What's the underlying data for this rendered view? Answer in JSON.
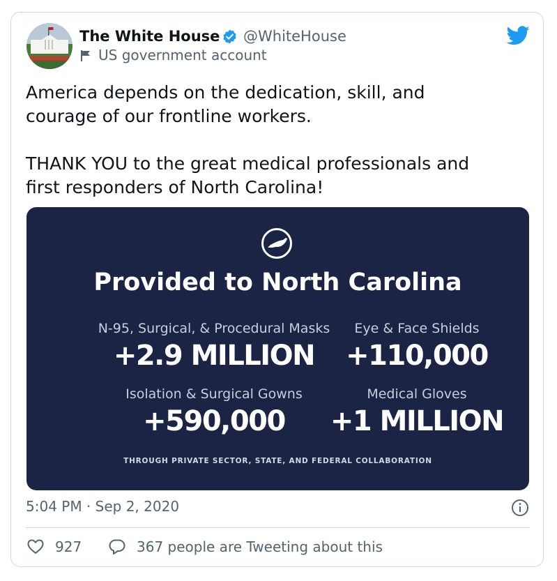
{
  "author": {
    "display_name": "The White House",
    "handle": "@WhiteHouse",
    "account_label": "US government account"
  },
  "tweet": {
    "text": "America depends on the dedication, skill, and\ncourage of our frontline workers.\n\nTHANK YOU to the great medical professionals and\nfirst responders of North Carolina!"
  },
  "media": {
    "title": "Provided to North Carolina",
    "stats": [
      {
        "label": "N-95, Surgical, & Procedural Masks",
        "value": "+2.9 MILLION"
      },
      {
        "label": "Eye & Face Shields",
        "value": "+110,000"
      },
      {
        "label": "Isolation & Surgical Gowns",
        "value": "+590,000"
      },
      {
        "label": "Medical Gloves",
        "value": "+1 MILLION"
      }
    ],
    "footnote": "THROUGH PRIVATE SECTOR, STATE, AND FEDERAL COLLABORATION"
  },
  "meta": {
    "timestamp": "5:04 PM · Sep 2, 2020",
    "likes": "927",
    "conversation": "367 people are Tweeting about this"
  },
  "icons": {
    "verified": "verified-badge-icon",
    "flag": "flag-icon",
    "brand": "twitter-bird-icon",
    "info": "info-icon",
    "like": "heart-icon",
    "reply": "speech-bubble-icon"
  },
  "colors": {
    "brand_blue": "#1d9bf0",
    "media_background": "#1b2444",
    "secondary_text": "#536471"
  }
}
